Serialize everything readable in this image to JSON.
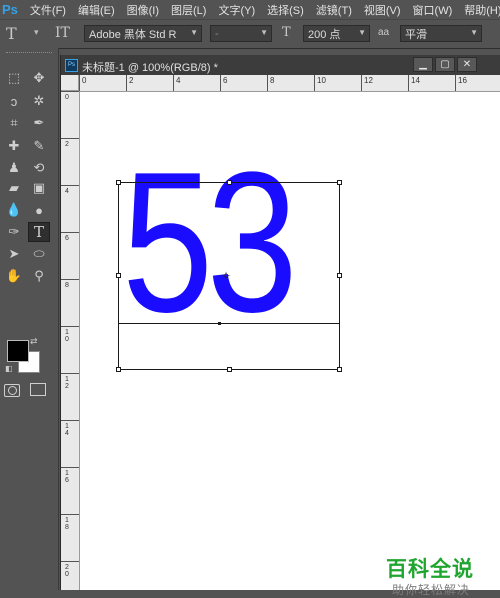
{
  "app": {
    "logo": "Ps"
  },
  "menu": [
    "文件(F)",
    "编辑(E)",
    "图像(I)",
    "图层(L)",
    "文字(Y)",
    "选择(S)",
    "滤镜(T)",
    "视图(V)",
    "窗口(W)",
    "帮助(H)"
  ],
  "options_bar": {
    "tool_icon": "T",
    "orientation_icon": "IT",
    "font_family": "Adobe 黑体 Std R",
    "font_style": "-",
    "size_icon": "T",
    "font_size": "200 点",
    "aa_icon": "aa",
    "antialias": "平滑"
  },
  "toolbox": {
    "tools": [
      {
        "name": "marquee-tool-icon",
        "glyph": "⬚"
      },
      {
        "name": "move-tool-icon",
        "glyph": "✥"
      },
      {
        "name": "lasso-tool-icon",
        "glyph": "ↄ"
      },
      {
        "name": "magic-wand-tool-icon",
        "glyph": "✲"
      },
      {
        "name": "crop-tool-icon",
        "glyph": "⌗"
      },
      {
        "name": "eyedropper-tool-icon",
        "glyph": "✒"
      },
      {
        "name": "healing-brush-tool-icon",
        "glyph": "✚"
      },
      {
        "name": "brush-tool-icon",
        "glyph": "✎"
      },
      {
        "name": "stamp-tool-icon",
        "glyph": "♟"
      },
      {
        "name": "history-brush-tool-icon",
        "glyph": "⟲"
      },
      {
        "name": "eraser-tool-icon",
        "glyph": "▰"
      },
      {
        "name": "gradient-tool-icon",
        "glyph": "▣"
      },
      {
        "name": "blur-tool-icon",
        "glyph": "💧"
      },
      {
        "name": "dodge-tool-icon",
        "glyph": "●"
      },
      {
        "name": "pen-tool-icon",
        "glyph": "✑"
      },
      {
        "name": "type-tool-icon",
        "glyph": "T"
      },
      {
        "name": "path-selection-tool-icon",
        "glyph": "➤"
      },
      {
        "name": "ellipse-tool-icon",
        "glyph": "⬭"
      },
      {
        "name": "hand-tool-icon",
        "glyph": "✋"
      },
      {
        "name": "zoom-tool-icon",
        "glyph": "⚲"
      }
    ],
    "colors": {
      "foreground": "#000000",
      "background": "#ffffff"
    }
  },
  "document": {
    "title": "未标题-1 @ 100%(RGB/8) *",
    "ruler_h_labels": [
      "0",
      "2",
      "4",
      "6",
      "8",
      "10",
      "12",
      "14",
      "16"
    ],
    "ruler_v_labels": [
      "0",
      "2",
      "4",
      "6",
      "8",
      "10",
      "12",
      "14",
      "16",
      "18",
      "20"
    ],
    "canvas_text": "53",
    "text_color": "#1a0cff"
  },
  "watermark": {
    "main": "百科全说",
    "sub": "助你轻松解决",
    "color": "#21a531"
  }
}
